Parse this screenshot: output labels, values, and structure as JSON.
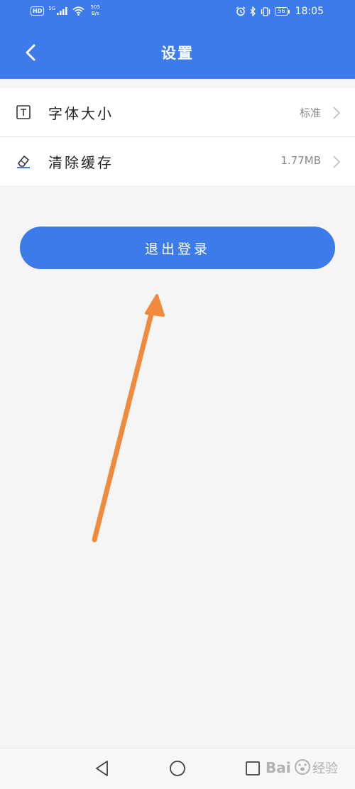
{
  "status_bar": {
    "hd": "HD",
    "signal_gen": "5G",
    "net_speed_value": "505",
    "net_speed_unit": "B/s",
    "battery": "56",
    "time": "18:05",
    "icons": [
      "signal-icon",
      "wifi-icon",
      "alarm-icon",
      "bluetooth-icon",
      "vibrate-icon",
      "battery-icon"
    ]
  },
  "header": {
    "title": "设置",
    "back_icon": "chevron-left-icon"
  },
  "settings": {
    "items": [
      {
        "icon": "font-size-icon",
        "label": "字体大小",
        "value": "标准"
      },
      {
        "icon": "eraser-icon",
        "label": "清除缓存",
        "value": "1.77MB"
      }
    ]
  },
  "logout": {
    "label": "退出登录"
  },
  "nav": {
    "icons": [
      "back-triangle-icon",
      "home-circle-icon",
      "recents-square-icon"
    ]
  },
  "watermark": {
    "text": "Bai 经验"
  },
  "colors": {
    "primary": "#3e7bea",
    "background": "#f5f5f5",
    "arrow": "#f08a3c"
  }
}
